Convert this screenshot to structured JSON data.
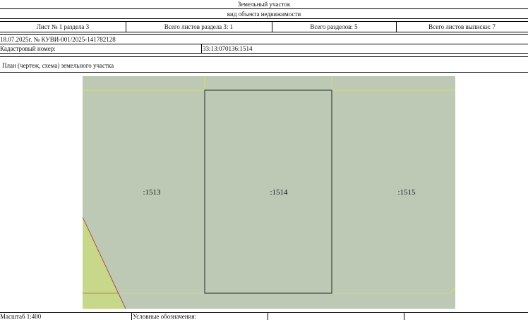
{
  "header": {
    "title": "Земельный участок",
    "subtitle": "вид объекта недвижимости"
  },
  "sheet_row": {
    "sheet": "Лист № 1 раздела 3",
    "total_sheets_section": "Всего листов раздела 3: 1",
    "total_sections": "Всего разделов: 5",
    "total_sheets_extract": "Всего листов выписки: 7"
  },
  "doc_ref": "18.07.2025г. № КУВИ-001/2025-141782128",
  "cadastral": {
    "label": "Кадастровый номер:",
    "value": "33:13:070136:1514"
  },
  "plan_title": "План (чертеж, схема) земельного участка",
  "plan": {
    "parcels": [
      {
        "label": ":1513"
      },
      {
        "label": ":1514"
      },
      {
        "label": ":1515"
      }
    ],
    "colors": {
      "background": "#bdc9b5",
      "boundary_yellow": "#d8e06a",
      "subject_outline": "#1e2a1e",
      "red_line": "#a8322e",
      "light_patch": "#c8d88a"
    }
  },
  "footer": {
    "scale_label": "Масштаб 1:400",
    "legend_label": "Условные обозначения:"
  }
}
